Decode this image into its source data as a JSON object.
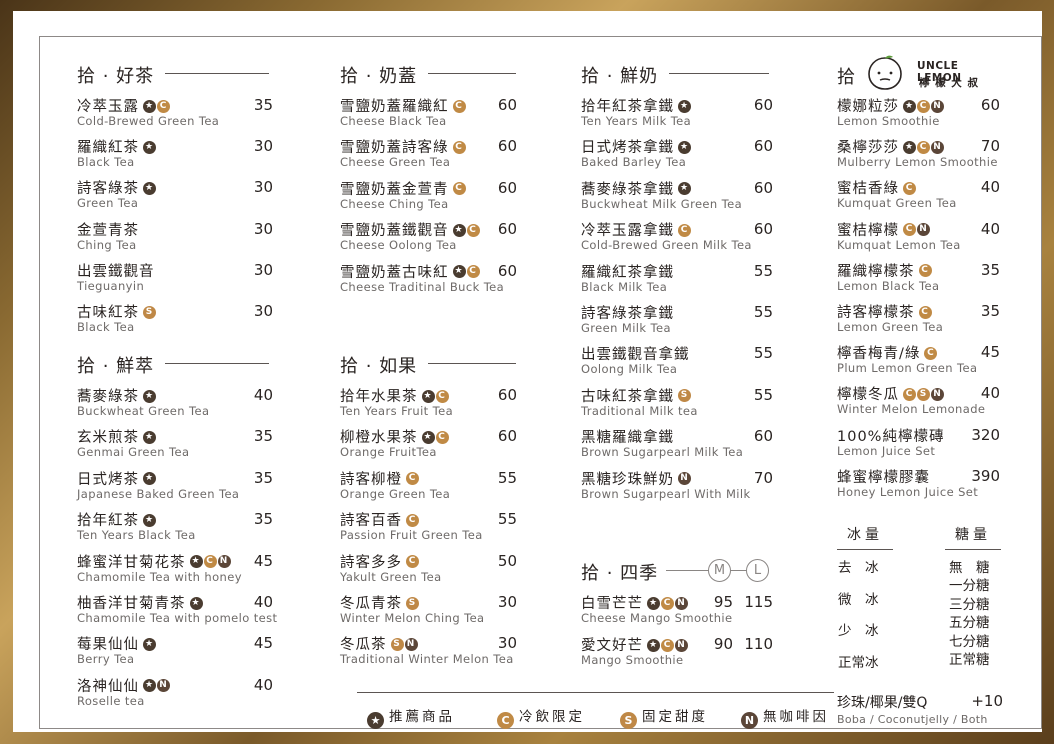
{
  "col1": {
    "sections": [
      {
        "title": "拾 · 好茶",
        "items": [
          {
            "zh": "冷萃玉露",
            "en": "Cold-Brewed Green Tea",
            "price": "35",
            "badges": [
              "star",
              "c"
            ]
          },
          {
            "zh": "羅織紅茶",
            "en": "Black Tea",
            "price": "30",
            "badges": [
              "star"
            ]
          },
          {
            "zh": "詩客綠茶",
            "en": "Green Tea",
            "price": "30",
            "badges": [
              "star"
            ]
          },
          {
            "zh": "金萱青茶",
            "en": "Ching Tea",
            "price": "30",
            "badges": []
          },
          {
            "zh": "出雲鐵觀音",
            "en": "Tieguanyin",
            "price": "30",
            "badges": []
          },
          {
            "zh": "古味紅茶",
            "en": "Black Tea",
            "price": "30",
            "badges": [
              "s"
            ]
          }
        ]
      },
      {
        "title": "拾 · 鮮萃",
        "items": [
          {
            "zh": "蕎麥綠茶",
            "en": "Buckwheat Green Tea",
            "price": "40",
            "badges": [
              "star"
            ]
          },
          {
            "zh": "玄米煎茶",
            "en": "Genmai Green Tea",
            "price": "35",
            "badges": [
              "star"
            ]
          },
          {
            "zh": "日式烤茶",
            "en": "Japanese Baked Green Tea",
            "price": "35",
            "badges": [
              "star"
            ]
          },
          {
            "zh": "拾年紅茶",
            "en": "Ten Years Black Tea",
            "price": "35",
            "badges": [
              "star"
            ]
          },
          {
            "zh": "蜂蜜洋甘菊花茶",
            "en": "Chamomile Tea with honey",
            "price": "45",
            "badges": [
              "star",
              "c",
              "n"
            ]
          },
          {
            "zh": "柚香洋甘菊青茶",
            "en": "Chamomile Tea with pomelo test",
            "price": "40",
            "badges": [
              "star"
            ]
          },
          {
            "zh": "莓果仙仙",
            "en": "Berry Tea",
            "price": "45",
            "badges": [
              "star"
            ]
          },
          {
            "zh": "洛神仙仙",
            "en": "Roselle tea",
            "price": "40",
            "badges": [
              "star",
              "n"
            ]
          }
        ]
      }
    ]
  },
  "col2": {
    "sections": [
      {
        "title": "拾 · 奶蓋",
        "items": [
          {
            "zh": "雪鹽奶蓋羅織紅",
            "en": "Cheese Black Tea",
            "price": "60",
            "badges": [
              "c"
            ]
          },
          {
            "zh": "雪鹽奶蓋詩客綠",
            "en": "Cheese Green Tea",
            "price": "60",
            "badges": [
              "c"
            ]
          },
          {
            "zh": "雪鹽奶蓋金萱青",
            "en": "Cheese Ching Tea",
            "price": "60",
            "badges": [
              "c"
            ]
          },
          {
            "zh": "雪鹽奶蓋鐵觀音",
            "en": "Cheese Oolong Tea",
            "price": "60",
            "badges": [
              "star",
              "c"
            ]
          },
          {
            "zh": "雪鹽奶蓋古味紅",
            "en": "Cheese Traditinal Buck Tea",
            "price": "60",
            "badges": [
              "star",
              "c"
            ]
          }
        ]
      },
      {
        "title": "拾 · 如果",
        "items": [
          {
            "zh": "拾年水果茶",
            "en": "Ten Years Fruit Tea",
            "price": "60",
            "badges": [
              "star",
              "c"
            ]
          },
          {
            "zh": "柳橙水果茶",
            "en": "Orange FruitTea",
            "price": "60",
            "badges": [
              "star",
              "c"
            ]
          },
          {
            "zh": "詩客柳橙",
            "en": "Orange Green Tea",
            "price": "55",
            "badges": [
              "c"
            ]
          },
          {
            "zh": "詩客百香",
            "en": "Passion Fruit Green Tea",
            "price": "55",
            "badges": [
              "c"
            ]
          },
          {
            "zh": "詩客多多",
            "en": "Yakult Green Tea",
            "price": "50",
            "badges": [
              "c"
            ]
          },
          {
            "zh": "冬瓜青茶",
            "en": "Winter Melon Ching Tea",
            "price": "30",
            "badges": [
              "s"
            ]
          },
          {
            "zh": "冬瓜茶",
            "en": "Traditional Winter Melon Tea",
            "price": "30",
            "badges": [
              "s",
              "n"
            ]
          }
        ]
      }
    ]
  },
  "col3": {
    "sections": [
      {
        "title": "拾 · 鮮奶",
        "items": [
          {
            "zh": "拾年紅茶拿鐵",
            "en": "Ten Years Milk Tea",
            "price": "60",
            "badges": [
              "star"
            ]
          },
          {
            "zh": "日式烤茶拿鐵",
            "en": "Baked Barley Tea",
            "price": "60",
            "badges": [
              "star"
            ]
          },
          {
            "zh": "蕎麥綠茶拿鐵",
            "en": "Buckwheat Milk Green Tea",
            "price": "60",
            "badges": [
              "star"
            ]
          },
          {
            "zh": "冷萃玉露拿鐵",
            "en": "Cold-Brewed Green Milk Tea",
            "price": "60",
            "badges": [
              "c"
            ]
          },
          {
            "zh": "羅織紅茶拿鐵",
            "en": "Black Milk Tea",
            "price": "55",
            "badges": []
          },
          {
            "zh": "詩客綠茶拿鐵",
            "en": "Green Milk Tea",
            "price": "55",
            "badges": []
          },
          {
            "zh": "出雲鐵觀音拿鐵",
            "en": "Oolong Milk Tea",
            "price": "55",
            "badges": []
          },
          {
            "zh": "古味紅茶拿鐵",
            "en": "Traditional Milk tea",
            "price": "55",
            "badges": [
              "s"
            ]
          },
          {
            "zh": "黑糖羅織拿鐵",
            "en": "Brown Sugarpearl Milk Tea",
            "price": "60",
            "badges": []
          },
          {
            "zh": "黑糖珍珠鮮奶",
            "en": "Brown Sugarpearl With Milk",
            "price": "70",
            "badges": [
              "n"
            ]
          }
        ]
      }
    ],
    "season": {
      "title": "拾 · 四季",
      "size_m": "M",
      "size_l": "L",
      "items": [
        {
          "zh": "白雪芒芒",
          "en": "Cheese Mango Smoothie",
          "price_m": "95",
          "price_l": "115",
          "badges": [
            "star",
            "c",
            "n"
          ]
        },
        {
          "zh": "愛文好芒",
          "en": "Mango Smoothie",
          "price_m": "90",
          "price_l": "110",
          "badges": [
            "star",
            "c",
            "n"
          ]
        }
      ]
    }
  },
  "col4": {
    "title": "拾",
    "brand_en": "UNCLE LEMON",
    "brand_zh": "檸 檬 大 叔",
    "items": [
      {
        "zh": "檬娜粒莎",
        "en": "Lemon Smoothie",
        "price": "60",
        "badges": [
          "star",
          "c",
          "n"
        ]
      },
      {
        "zh": "桑檸莎莎",
        "en": "Mulberry Lemon Smoothie",
        "price": "70",
        "badges": [
          "star",
          "c",
          "n"
        ]
      },
      {
        "zh": "蜜桔香綠",
        "en": "Kumquat Green Tea",
        "price": "40",
        "badges": [
          "c"
        ]
      },
      {
        "zh": "蜜桔檸檬",
        "en": "Kumquat Lemon Tea",
        "price": "40",
        "badges": [
          "c",
          "n"
        ]
      },
      {
        "zh": "羅織檸檬茶",
        "en": "Lemon Black Tea",
        "price": "35",
        "badges": [
          "c"
        ]
      },
      {
        "zh": "詩客檸檬茶",
        "en": "Lemon Green Tea",
        "price": "35",
        "badges": [
          "c"
        ]
      },
      {
        "zh": "檸香梅青/綠",
        "en": "Plum Lemon Green Tea",
        "price": "45",
        "badges": [
          "c"
        ]
      },
      {
        "zh": "檸檬冬瓜",
        "en": "Winter Melon Lemonade",
        "price": "40",
        "badges": [
          "c",
          "s",
          "n"
        ]
      },
      {
        "zh": "100%純檸檬磚",
        "en": "Lemon Juice Set",
        "price": "320",
        "badges": []
      },
      {
        "zh": "蜂蜜檸檬膠囊",
        "en": "Honey Lemon Juice Set",
        "price": "390",
        "badges": []
      }
    ],
    "ice_title": "冰量",
    "sugar_title": "糖量",
    "ice_levels": [
      "去　冰",
      "微　冰",
      "少　冰",
      "正常冰"
    ],
    "sugar_levels": [
      "無　糖",
      "一分糖",
      "三分糖",
      "五分糖",
      "七分糖",
      "正常糖"
    ],
    "addon_zh": "珍珠/椰果/雙Q",
    "addon_price": "+10",
    "addon_en": "Boba / Coconutjelly / Both"
  },
  "legend": [
    {
      "icon": "star",
      "label": "推薦商品"
    },
    {
      "icon": "c",
      "label": "冷飲限定"
    },
    {
      "icon": "s",
      "label": "固定甜度"
    },
    {
      "icon": "n",
      "label": "無咖啡因"
    }
  ],
  "badge_glyphs": {
    "star": "★",
    "c": "C",
    "s": "S",
    "n": "N"
  }
}
